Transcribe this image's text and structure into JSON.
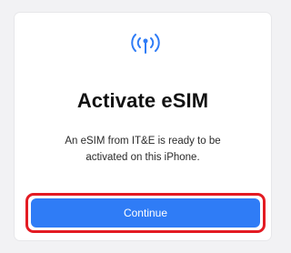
{
  "dialog": {
    "icon": "cellular-signal-icon",
    "title": "Activate eSIM",
    "description": "An eSIM from IT&E is ready to be activated on this iPhone.",
    "continue_label": "Continue"
  },
  "colors": {
    "accent": "#2f7cf6",
    "highlight_border": "#e31b23",
    "title_text": "#111111",
    "background": "#f2f2f4"
  }
}
